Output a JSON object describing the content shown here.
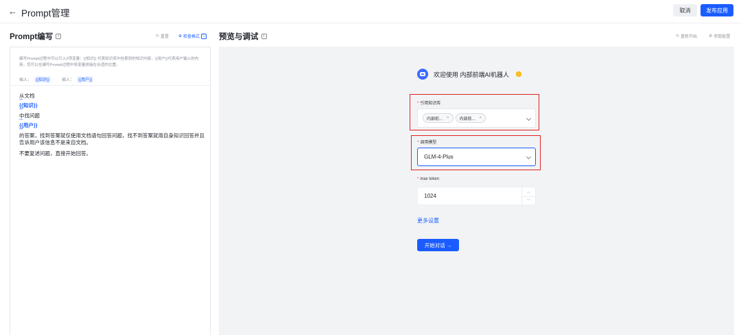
{
  "header": {
    "back_icon": "arrow-left-icon",
    "title": "Prompt管理",
    "cancel_label": "取消",
    "publish_label": "发布应用"
  },
  "left": {
    "title": "Prompt编写",
    "reset_label": "重置",
    "check_label": "检查格式",
    "description": "编写Prompt过程中可以引入2项变量：{{知识}} 代表知识库中检索到的知识内容，{{用户}}代表用户输入的内容。您可以在编写Prompt过程中将变量拼接在合适的位置。",
    "insert_label_1": "插入：",
    "insert_tag_1": "{{知识}}",
    "insert_label_2": "插入：",
    "insert_tag_2": "{{用户}}",
    "prompt": {
      "line1": "从文档",
      "mark": "\"\"\"",
      "var_knowledge": "{{知识}}",
      "line2": "中找问题",
      "var_user": "{{用户}}",
      "line3": "的答案，找到答案就仅使用文档语句回答问题，找不到答案就用自身知识回答并且告诉用户该信息不是来自文档。",
      "line4": "不要复述问题，直接开始回答。"
    }
  },
  "right": {
    "title": "预览与调试",
    "restart_label": "重新开始",
    "params_label": "参数配置",
    "welcome": "欢迎使用 内部前端AI机器人",
    "kb_label": "引用知识库",
    "kb_chips": [
      "内部前...",
      "内部前..."
    ],
    "model_label": "调用模型",
    "model_value": "GLM-4-Plus",
    "token_label": "max token",
    "token_value": "1024",
    "more_label": "更多设置",
    "start_label": "开始对话 →"
  }
}
